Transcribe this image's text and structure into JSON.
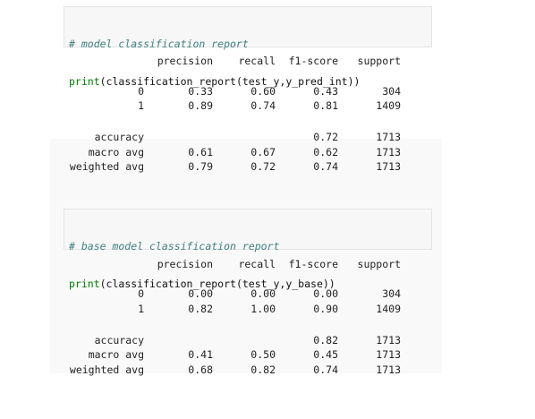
{
  "cells": [
    {
      "comment": "# model classification report",
      "code_fn": "print",
      "code_rest": "(classification_report(test_y,y_pred_int))",
      "report": {
        "headers": [
          "precision",
          "recall",
          "f1-score",
          "support"
        ],
        "class_rows": [
          {
            "label": "0",
            "precision": "0.33",
            "recall": "0.60",
            "f1": "0.43",
            "support": "304"
          },
          {
            "label": "1",
            "precision": "0.89",
            "recall": "0.74",
            "f1": "0.81",
            "support": "1409"
          }
        ],
        "summary_rows": [
          {
            "label": "accuracy",
            "precision": "",
            "recall": "",
            "f1": "0.72",
            "support": "1713"
          },
          {
            "label": "macro avg",
            "precision": "0.61",
            "recall": "0.67",
            "f1": "0.62",
            "support": "1713"
          },
          {
            "label": "weighted avg",
            "precision": "0.79",
            "recall": "0.72",
            "f1": "0.74",
            "support": "1713"
          }
        ]
      }
    },
    {
      "comment": "# base model classification report",
      "code_fn": "print",
      "code_rest": "(classification_report(test_y,y_base))",
      "report": {
        "headers": [
          "precision",
          "recall",
          "f1-score",
          "support"
        ],
        "class_rows": [
          {
            "label": "0",
            "precision": "0.00",
            "recall": "0.00",
            "f1": "0.00",
            "support": "304"
          },
          {
            "label": "1",
            "precision": "0.82",
            "recall": "1.00",
            "f1": "0.90",
            "support": "1409"
          }
        ],
        "summary_rows": [
          {
            "label": "accuracy",
            "precision": "",
            "recall": "",
            "f1": "0.82",
            "support": "1713"
          },
          {
            "label": "macro avg",
            "precision": "0.41",
            "recall": "0.50",
            "f1": "0.45",
            "support": "1713"
          },
          {
            "label": "weighted avg",
            "precision": "0.68",
            "recall": "0.82",
            "f1": "0.74",
            "support": "1713"
          }
        ]
      }
    }
  ],
  "colors": {
    "comment": "#408080",
    "keyword": "#008000",
    "input_background": "#f7f7f7"
  }
}
